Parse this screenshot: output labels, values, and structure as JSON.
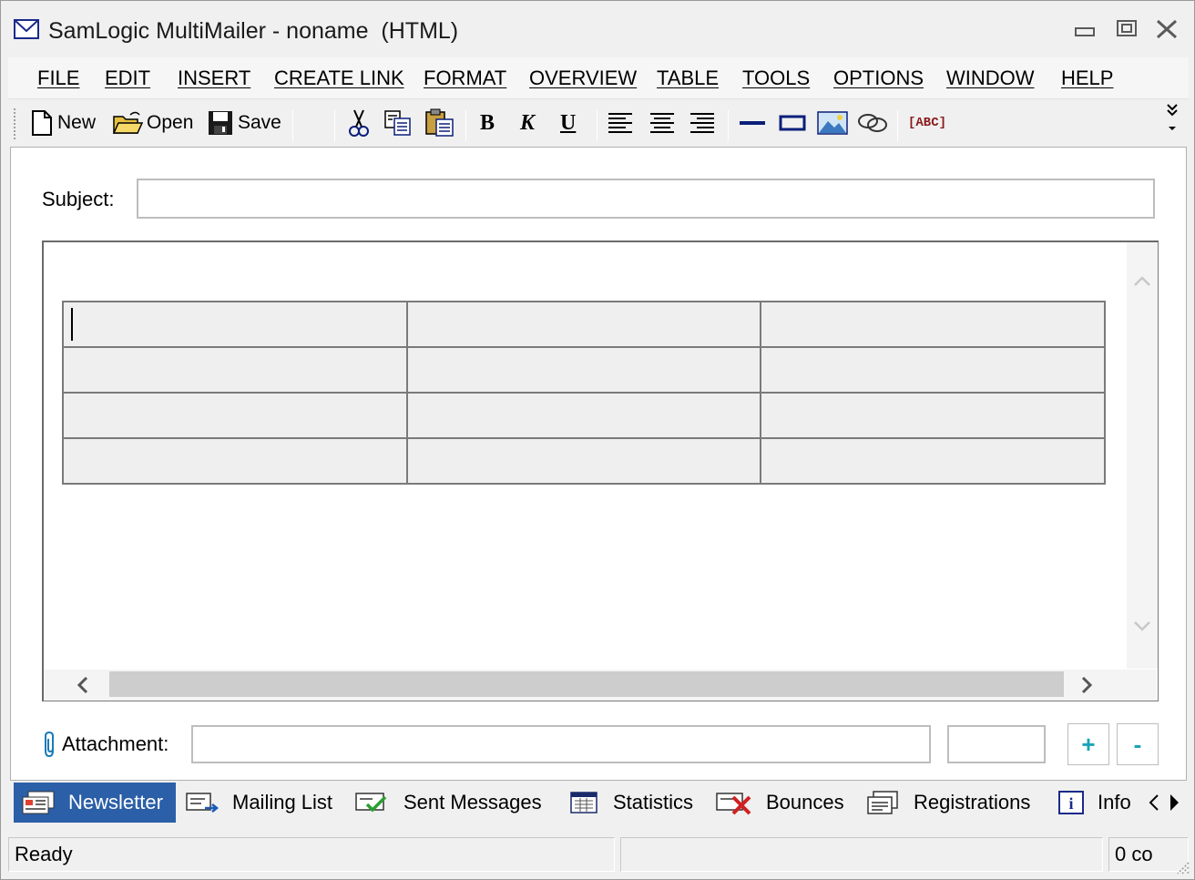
{
  "window": {
    "title": "SamLogic MultiMailer - noname  (HTML)"
  },
  "menu": {
    "items": [
      "FILE",
      "EDIT",
      "INSERT",
      "CREATE LINK",
      "FORMAT",
      "OVERVIEW",
      "TABLE",
      "TOOLS",
      "OPTIONS",
      "WINDOW",
      "HELP"
    ]
  },
  "toolbar": {
    "new_label": "New",
    "open_label": "Open",
    "save_label": "Save",
    "bold_glyph": "B",
    "italic_glyph": "K",
    "underline_glyph": "U",
    "spellcheck_glyph": "[ABC]",
    "icons": [
      "new-document-icon",
      "open-folder-icon",
      "save-disk-icon",
      "cut-scissors-icon",
      "copy-icon",
      "paste-icon",
      "bold-icon",
      "italic-icon",
      "underline-icon",
      "align-left-icon",
      "align-center-icon",
      "align-right-icon",
      "horizontal-line-icon",
      "box-icon",
      "image-icon",
      "link-icon",
      "spellcheck-icon"
    ]
  },
  "editor": {
    "subject_label": "Subject:",
    "subject_value": "",
    "table": {
      "rows": 4,
      "cols": 3
    }
  },
  "attachment": {
    "label": "Attachment:",
    "value": "",
    "size_value": "",
    "add_label": "+",
    "remove_label": "-"
  },
  "tabs": {
    "items": [
      "Newsletter",
      "Mailing List",
      "Sent Messages",
      "Statistics",
      "Bounces",
      "Registrations",
      "Info"
    ],
    "active": "Newsletter"
  },
  "status": {
    "text": "Ready",
    "middle": "",
    "count": "0 co"
  },
  "colors": {
    "active_tab": "#2b5fa8",
    "accent": "#1aa3b8",
    "navy_icon": "#0b1f7a"
  }
}
